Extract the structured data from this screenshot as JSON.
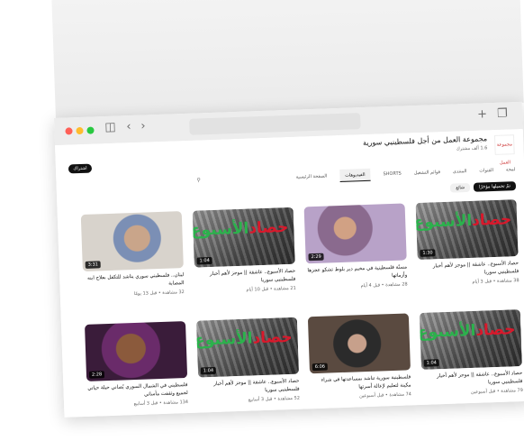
{
  "channel": {
    "name": "مجموعة العمل من أجل فلسطينيي سورية",
    "subscribers": "1.6 ألف مشترك",
    "join_label": "اشتراك",
    "avatar_label": "مجموعة العمل"
  },
  "tabs": [
    {
      "label": "الصفحة الرئيسية"
    },
    {
      "label": "الفيديوهات",
      "active": true
    },
    {
      "label": "SHORTS"
    },
    {
      "label": "قوائم التشغيل"
    },
    {
      "label": "المنتدى"
    },
    {
      "label": "القنوات"
    },
    {
      "label": "لمحة"
    }
  ],
  "filters": [
    {
      "label": "تمّ تحميلها مؤخرًا",
      "active": true
    },
    {
      "label": "شائع"
    }
  ],
  "videos": [
    {
      "duration": "1:30",
      "title": "حصاد الأسبوع.. عاشقة || موجز لأهم أخبار فلسطينيي سوريا",
      "meta": "38 مشاهدة • قبل 3 أيام",
      "thumb": "hasad"
    },
    {
      "duration": "2:29",
      "title": "مسنّة فلسطينية في مخيم دير بلوط تشكو عجزها وأزماتها",
      "meta": "28 مشاهدة • قبل 4 أيام",
      "thumb": "portrait-2"
    },
    {
      "duration": "1:04",
      "title": "حصاد الأسبوع.. عاشقة || موجز لأهم أخبار فلسطينيي سوريا",
      "meta": "21 مشاهدة • قبل 10 أيام",
      "thumb": "hasad"
    },
    {
      "duration": "3:31",
      "title": "لبنان.. فلسطيني سوري يناشد للتكفل بعلاج ابنه المصابة",
      "meta": "32 مشاهدة • قبل 13 يومًا",
      "thumb": "portrait-1"
    },
    {
      "duration": "1:04",
      "title": "حصاد الأسبوع.. عاشقة || موجز لأهم أخبار فلسطينيي سوريا",
      "meta": "79 مشاهدة • قبل أسبوعين",
      "thumb": "hasad"
    },
    {
      "duration": "6:06",
      "title": "فلسطينية سورية تناشد بمساعدتها في شراء مكينة لتعليم لإعالة أسرتها",
      "meta": "74 مشاهدة • قبل أسبوعين",
      "thumb": "portrait-4"
    },
    {
      "duration": "1:04",
      "title": "حصاد الأسبوع.. عاشقة || موجز لأهم أخبار فلسطينيي سوريا",
      "meta": "52 مشاهدة • قبل 3 أسابيع",
      "thumb": "hasad"
    },
    {
      "duration": "2:28",
      "title": "فلسطيني في الشمال السوري يُصاني حيلة حياتي لجميع وثقفت مأساتي",
      "meta": "134 مشاهدة • قبل 3 أسابيع",
      "thumb": "portrait-3"
    }
  ],
  "thumb_text": {
    "line_red": "حصاد",
    "line_green": "الأسبوع"
  }
}
